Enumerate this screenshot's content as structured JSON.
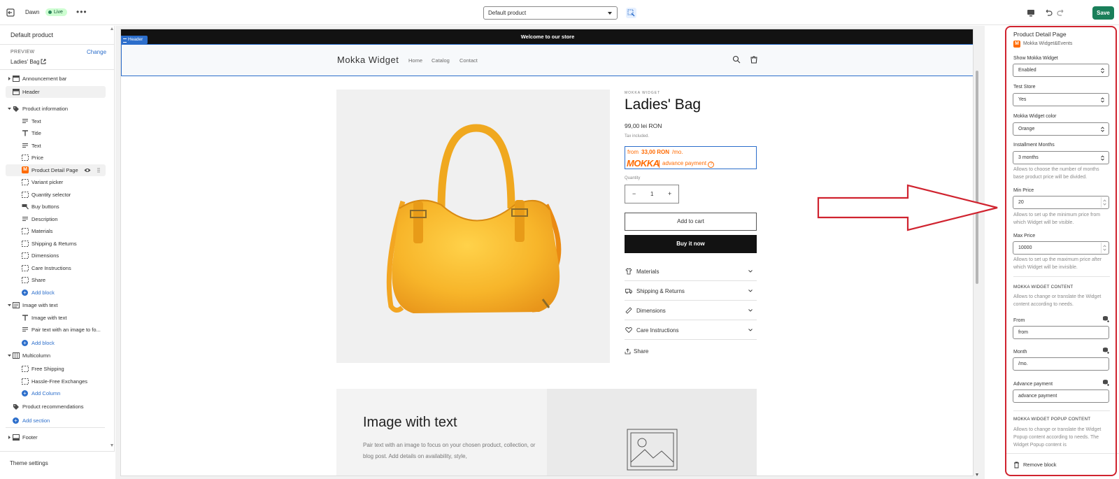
{
  "topbar": {
    "theme_name": "Dawn",
    "live_badge": "Live",
    "template_select": "Default product",
    "save_label": "Save"
  },
  "left_panel": {
    "title": "Default product",
    "preview_label": "PREVIEW",
    "change_link": "Change",
    "preview_product": "Ladies' Bag",
    "tree": {
      "announcement_bar": "Announcement bar",
      "header": "Header",
      "product_information": "Product information",
      "blocks": [
        "Text",
        "Title",
        "Text",
        "Price",
        "Product Detail Page",
        "Variant picker",
        "Quantity selector",
        "Buy buttons",
        "Description",
        "Materials",
        "Shipping & Returns",
        "Dimensions",
        "Care Instructions",
        "Share"
      ],
      "add_block": "Add block",
      "image_with_text": "Image with text",
      "iwt_blocks": [
        "Image with text",
        "Pair text with an image to fo..."
      ],
      "add_block_2": "Add block",
      "multicolumn": "Multicolumn",
      "multicolumn_blocks": [
        "Free Shipping",
        "Hassle-Free Exchanges"
      ],
      "add_column": "Add Column",
      "product_recommendations": "Product recommendations",
      "add_section": "Add section",
      "footer": "Footer"
    },
    "theme_settings": "Theme settings"
  },
  "preview": {
    "announcement": "Welcome to our store",
    "header_tag": "Header",
    "store_logo": "Mokka Widget",
    "nav": [
      "Home",
      "Catalog",
      "Contact"
    ],
    "vendor": "MOKKA WIDGET",
    "product_title": "Ladies' Bag",
    "price": "99,00 lei RON",
    "tax_note": "Tax included.",
    "mokka_widget": {
      "from": "from",
      "amount": "33,00 RON",
      "per_month": "/mo.",
      "logo_text": "MOKKA",
      "advance_payment": "advance payment"
    },
    "quantity_label": "Quantity",
    "quantity_value": "1",
    "add_to_cart": "Add to cart",
    "buy_now": "Buy it now",
    "accordions": [
      "Materials",
      "Shipping & Returns",
      "Dimensions",
      "Care Instructions"
    ],
    "share": "Share",
    "image_with_text": {
      "heading": "Image with text",
      "body": "Pair text with an image to focus on your chosen product, collection, or blog post. Add details on availability, style,"
    }
  },
  "right_panel": {
    "title": "Product Detail Page",
    "app_name": "Mokka Widget&Events",
    "show_widget_label": "Show Mokka Widget",
    "show_widget_value": "Enabled",
    "test_store_label": "Test Store",
    "test_store_value": "Yes",
    "color_label": "Mokka Widget color",
    "color_value": "Orange",
    "installment_label": "Installment Months",
    "installment_value": "3 months",
    "installment_help": "Allows to choose the number of months base product price will be divided.",
    "min_price_label": "Min Price",
    "min_price_value": "20",
    "min_price_help": "Allows to set up the minimum price from which Widget will be visible.",
    "max_price_label": "Max Price",
    "max_price_value": "10000",
    "max_price_help": "Allows to set up the maximum price after which Widget will be invisible.",
    "content_heading": "MOKKA WIDGET CONTENT",
    "content_help": "Allows to change or translate the Widget content according to needs.",
    "from_label": "From",
    "from_value": "from",
    "month_label": "Month",
    "month_value": "/mo.",
    "advance_label": "Advance payment",
    "advance_value": "advance payment",
    "popup_heading": "MOKKA WIDGET POPUP CONTENT",
    "popup_help": "Allows to change or translate the Widget Popup content according to needs. The Widget Popup content is",
    "remove_block": "Remove block"
  },
  "colors": {
    "accent_blue": "#2c6ecb",
    "save_green": "#1a7f5a",
    "mokka_orange": "#ff6a00",
    "annotation_red": "#d0232f"
  }
}
